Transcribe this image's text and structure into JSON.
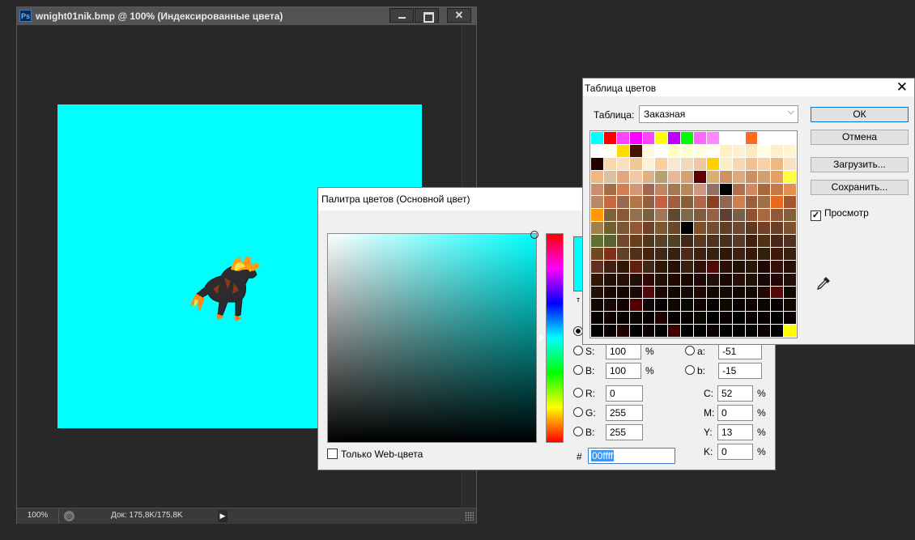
{
  "document": {
    "title": "wnight01nik.bmp @ 100% (Индексированные цвета)",
    "app_icon": "Ps",
    "canvas_color": "#00ffff",
    "status": {
      "zoom": "100%",
      "doc_size": "Док: 175,8K/175,8K"
    }
  },
  "color_picker": {
    "title": "Палитра цветов (Основной цвет)",
    "selected_color": "#00ffff",
    "web_only_label": "Только Web-цвета",
    "fields": {
      "s": {
        "label": "S:",
        "value": "100",
        "unit": "%"
      },
      "b": {
        "label": "B:",
        "value": "100",
        "unit": "%"
      },
      "r": {
        "label": "R:",
        "value": "0"
      },
      "g": {
        "label": "G:",
        "value": "255"
      },
      "bl": {
        "label": "B:",
        "value": "255"
      },
      "a": {
        "label": "a:",
        "value": "-51"
      },
      "lab_b": {
        "label": "b:",
        "value": "-15"
      },
      "c": {
        "label": "C:",
        "value": "52",
        "unit": "%"
      },
      "m": {
        "label": "M:",
        "value": "0",
        "unit": "%"
      },
      "y": {
        "label": "Y:",
        "value": "13",
        "unit": "%"
      },
      "k": {
        "label": "K:",
        "value": "0",
        "unit": "%"
      }
    },
    "hex_label": "#",
    "hex_value": "00ffff",
    "new_label": "т"
  },
  "color_table": {
    "title": "Таблица цветов",
    "table_label": "Таблица:",
    "table_value": "Заказная",
    "buttons": {
      "ok": "ОК",
      "cancel": "Отмена",
      "load": "Загрузить...",
      "save": "Сохранить..."
    },
    "preview_label": "Просмотр",
    "swatches": [
      "#00ffff",
      "#ff0000",
      "#ff44ff",
      "#ff00ff",
      "#ff44ff",
      "#ffff00",
      "#c000ff",
      "#00ff00",
      "#ff66ff",
      "#ff88ff",
      "#ffffff",
      "#ffffff",
      "#ff6a20",
      "#ffffff",
      "#ffffff",
      "#ffffff",
      "#ffffff",
      "#ffffee",
      "#ffdd00",
      "#4a1000",
      "#fff8e0",
      "#ffffff",
      "#ffffc0",
      "#ffffd0",
      "#ffffe0",
      "#ffffee",
      "#fff0c0",
      "#fff0d0",
      "#ffe8c0",
      "#ffffe8",
      "#ffeecc",
      "#fff4d0",
      "#200000",
      "#f8d8b0",
      "#f8e0c0",
      "#f0c898",
      "#fff0d8",
      "#f8d0a0",
      "#f8e8d0",
      "#f0d8b8",
      "#f0c8a0",
      "#ffd000",
      "#f8f0c0",
      "#f8d8b0",
      "#f0c090",
      "#f8d0a8",
      "#f0b880",
      "#f8e0c0",
      "#f0b880",
      "#d8c0a0",
      "#e0a880",
      "#f0c8a8",
      "#e0b080",
      "#b8a070",
      "#e8b898",
      "#d8a070",
      "#600000",
      "#d8b070",
      "#d09060",
      "#e0a878",
      "#c89060",
      "#d0a070",
      "#e8a060",
      "#ffff40",
      "#c89070",
      "#a07048",
      "#d08050",
      "#d09878",
      "#a06850",
      "#c08860",
      "#a87850",
      "#b88858",
      "#d09880",
      "#907060",
      "#000000",
      "#b07048",
      "#d08860",
      "#a86840",
      "#c87848",
      "#e09050",
      "#b88868",
      "#c86840",
      "#986850",
      "#b07848",
      "#906040",
      "#c86040",
      "#a06040",
      "#886038",
      "#b06848",
      "#884020",
      "#906850",
      "#d08050",
      "#986040",
      "#a07048",
      "#e86820",
      "#a05830",
      "#ff9800",
      "#806040",
      "#885838",
      "#907050",
      "#786040",
      "#a07858",
      "#604830",
      "#806848",
      "#7e5c40",
      "#986048",
      "#604030",
      "#786048",
      "#905030",
      "#a86840",
      "#905838",
      "#806038",
      "#a08050",
      "#706030",
      "#785838",
      "#905838",
      "#704028",
      "#805830",
      "#6a4828",
      "#000000",
      "#805028",
      "#705030",
      "#604020",
      "#704830",
      "#603820",
      "#704028",
      "#684028",
      "#805030",
      "#607030",
      "#586038",
      "#704830",
      "#684020",
      "#503820",
      "#584028",
      "#504028",
      "#402818",
      "#583820",
      "#503020",
      "#483020",
      "#583828",
      "#402010",
      "#503018",
      "#482818",
      "#503020",
      "#704820",
      "#803018",
      "#604028",
      "#503018",
      "#482010",
      "#402818",
      "#382010",
      "#502818",
      "#402010",
      "#382010",
      "#301808",
      "#402010",
      "#381808",
      "#302010",
      "#401808",
      "#382010",
      "#603020",
      "#402010",
      "#301808",
      "#602010",
      "#402818",
      "#301808",
      "#281008",
      "#382010",
      "#301008",
      "#500808",
      "#281008",
      "#201008",
      "#281808",
      "#200808",
      "#301008",
      "#281008",
      "#301808",
      "#201008",
      "#281008",
      "#201008",
      "#300808",
      "#201008",
      "#200800",
      "#180800",
      "#200808",
      "#201008",
      "#180800",
      "#281008",
      "#201008",
      "#180808",
      "#200808",
      "#201008",
      "#201008",
      "#180800",
      "#100800",
      "#180808",
      "#500808",
      "#180800",
      "#100800",
      "#180808",
      "#200800",
      "#100800",
      "#180808",
      "#100800",
      "#100800",
      "#200800",
      "#500808",
      "#100800",
      "#100800",
      "#180808",
      "#100000",
      "#500000",
      "#100808",
      "#080000",
      "#100800",
      "#080800",
      "#100000",
      "#080000",
      "#100800",
      "#080000",
      "#100000",
      "#080800",
      "#080000",
      "#100800",
      "#080000",
      "#100000",
      "#080000",
      "#080800",
      "#080000",
      "#200000",
      "#080000",
      "#080000",
      "#080800",
      "#000000",
      "#080000",
      "#000000",
      "#080000",
      "#080000",
      "#000000",
      "#080000",
      "#000000",
      "#080000",
      "#200000",
      "#000000",
      "#080000",
      "#000000",
      "#400000",
      "#000000",
      "#000000",
      "#080000",
      "#000000",
      "#000000",
      "#000000",
      "#080000",
      "#000000",
      "#ffff00"
    ]
  }
}
